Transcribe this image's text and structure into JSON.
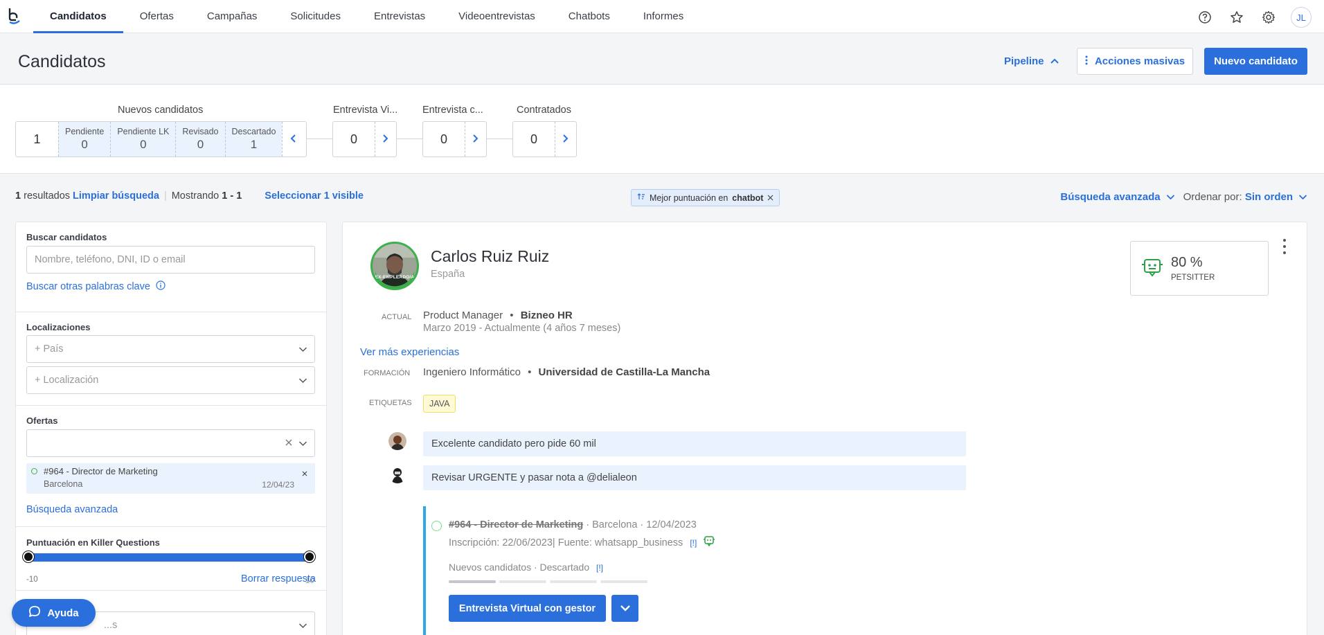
{
  "nav": {
    "tabs": [
      "Candidatos",
      "Ofertas",
      "Campañas",
      "Solicitudes",
      "Entrevistas",
      "Videoentrevistas",
      "Chatbots",
      "Informes"
    ],
    "user_initials": "JL"
  },
  "header": {
    "title": "Candidatos",
    "pipeline_label": "Pipeline",
    "bulk_actions_label": "Acciones masivas",
    "new_candidate_label": "Nuevo candidato"
  },
  "pipeline": {
    "stages": [
      {
        "title": "Nuevos candidatos",
        "count": "1",
        "substages": [
          {
            "label": "Pendiente",
            "value": "0"
          },
          {
            "label": "Pendiente LK",
            "value": "0"
          },
          {
            "label": "Revisado",
            "value": "0"
          },
          {
            "label": "Descartado",
            "value": "1"
          }
        ]
      },
      {
        "title": "Entrevista Vi...",
        "count": "0"
      },
      {
        "title": "Entrevista c...",
        "count": "0"
      },
      {
        "title": "Contratados",
        "count": "0"
      }
    ]
  },
  "results": {
    "count": "1",
    "count_suffix": "resultados",
    "clear_search": "Limpiar búsqueda",
    "showing_prefix": "Mostrando",
    "showing_range": "1 - 1",
    "select_visible": "Seleccionar 1 visible",
    "chip_prefix": "Mejor puntuación en",
    "chip_bold": "chatbot",
    "advanced_search": "Búsqueda avanzada",
    "sort_label": "Ordenar por:",
    "sort_value": "Sin orden"
  },
  "filters": {
    "search_label": "Buscar candidatos",
    "search_placeholder": "Nombre, teléfono, DNI, ID o email",
    "keywords_link": "Buscar otras palabras clave",
    "locations_label": "Localizaciones",
    "country_placeholder": "+ País",
    "location_placeholder": "+ Localización",
    "offers_label": "Ofertas",
    "offer_item": {
      "title": "#964 - Director de Marketing",
      "city": "Barcelona",
      "date": "12/04/23"
    },
    "advanced_search_link": "Búsqueda avanzada",
    "killer_label": "Puntuación en Killer Questions",
    "killer_min": "-10",
    "killer_max": "10",
    "killer_range": [
      -10,
      10
    ],
    "clear_answer": "Borrar respuesta",
    "next_placeholder": "...s"
  },
  "help": {
    "label": "Ayuda"
  },
  "candidate": {
    "name": "Carlos Ruiz Ruiz",
    "country": "España",
    "photo_badge": "EX-EMPLEADO/A",
    "score": "80 %",
    "score_label": "PETSITTER",
    "current_label": "ACTUAL",
    "job_title": "Product Manager",
    "company": "Bizneo HR",
    "period": "Marzo 2019 - Actualmente (4 años 7 meses)",
    "more_experience": "Ver más experiencias",
    "education_label": "FORMACIÓN",
    "degree": "Ingeniero Informático",
    "university": "Universidad de Castilla-La Mancha",
    "tags_label": "ETIQUETAS",
    "tags": [
      "JAVA"
    ],
    "notes": [
      "Excelente candidato pero pide 60 mil",
      "Revisar URGENTE y pasar nota a @delialeon"
    ],
    "application": {
      "offer": "#964 - Director de Marketing",
      "location_date": "· Barcelona · 12/04/2023",
      "registration": "Inscripción: 22/06/2023| Fuente: whatsapp_business",
      "marker": "[!]",
      "stage_text": "Nuevos candidatos · Descartado",
      "progress_completed": 1,
      "progress_total": 4,
      "action_label": "Entrevista Virtual con gestor"
    }
  },
  "colors": {
    "accent": "#2a6fdb",
    "chip_bg": "#e3edfb",
    "substage_bg": "#eaf2fd",
    "photo_ring": "#3cb04a",
    "application_bar": "#2fa8e8"
  }
}
